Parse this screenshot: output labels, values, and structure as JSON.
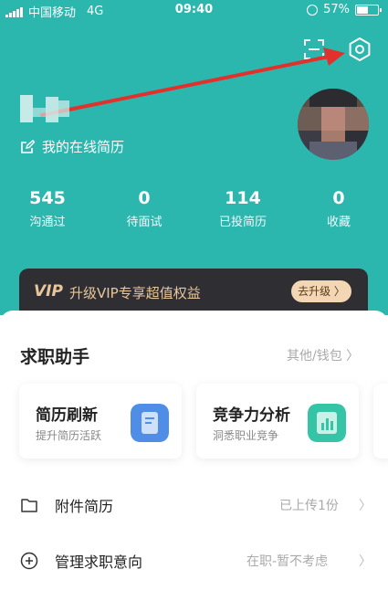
{
  "status_bar": {
    "carrier": "中国移动",
    "network": "4G",
    "time": "09:40",
    "battery_text": "57%",
    "battery_level": 0.57
  },
  "profile": {
    "online_resume_label": "我的在线简历"
  },
  "stats": [
    {
      "value": "545",
      "label": "沟通过"
    },
    {
      "value": "0",
      "label": "待面试"
    },
    {
      "value": "114",
      "label": "已投简历"
    },
    {
      "value": "0",
      "label": "收藏"
    }
  ],
  "vip": {
    "logo": "VIP",
    "text": "升级VIP专享超值权益",
    "button_label": "去升级 〉"
  },
  "job_assistant": {
    "title": "求职助手",
    "more_label": "其他/钱包 〉",
    "cards": [
      {
        "title": "简历刷新",
        "subtitle": "提升简历活跃",
        "icon": "resume-refresh-icon",
        "color": "#4f8de6"
      },
      {
        "title": "竞争力分析",
        "subtitle": "洞悉职业竞争",
        "icon": "competitiveness-icon",
        "color": "#35c4a6"
      }
    ]
  },
  "rows": [
    {
      "label": "附件简历",
      "value": "已上传1份",
      "icon": "folder-icon"
    },
    {
      "label": "管理求职意向",
      "value": "在职-暂不考虑",
      "icon": "plus-circle-icon"
    }
  ],
  "colors": {
    "header_bg": "#2cb7ae",
    "vip_gold": "#e8c69b",
    "annotation_arrow": "#e2302c"
  }
}
